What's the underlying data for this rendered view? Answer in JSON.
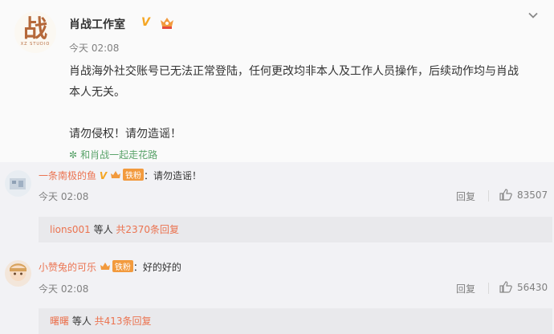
{
  "post": {
    "author": "肖战工作室",
    "verified_mark": "V",
    "time": "今天 02:08",
    "paragraphs": [
      "肖战海外社交账号已无法正常登陆，任何更改均非本人及工作人员操作，后续动作均与肖战本人无关。",
      "请勿侵权！请勿造谣！"
    ],
    "topic": "和肖战一起走花路",
    "logo_char": "战",
    "logo_sub": "XZ STUDIO"
  },
  "comments": [
    {
      "name": "一条南极的鱼",
      "verified_mark": "V",
      "fan_badge": "铁粉",
      "text": "：请勿造谣！",
      "time": "今天 02:08",
      "reply_label": "回复",
      "likes": "83507",
      "sub_replies": {
        "user": "lions001",
        "middle": " 等人 ",
        "count_text": "共2370条回复"
      }
    },
    {
      "name": "小赞兔的可乐",
      "fan_badge": "铁粉",
      "text": "：好的好的",
      "time": "今天 02:08",
      "reply_label": "回复",
      "likes": "56430",
      "sub_replies": {
        "user": "曙曙",
        "middle": " 等人 ",
        "count_text": "共413条回复"
      }
    }
  ],
  "icons": {
    "chevron": "chevron-down-icon",
    "like": "thumbs-up-icon",
    "vip": "vip-crown-icon",
    "flower": "flower-icon"
  },
  "colors": {
    "accent_link": "#eb7350",
    "topic_green": "#5aa36a",
    "gold": "#f5a623",
    "fan_orange": "#f29a3d"
  }
}
